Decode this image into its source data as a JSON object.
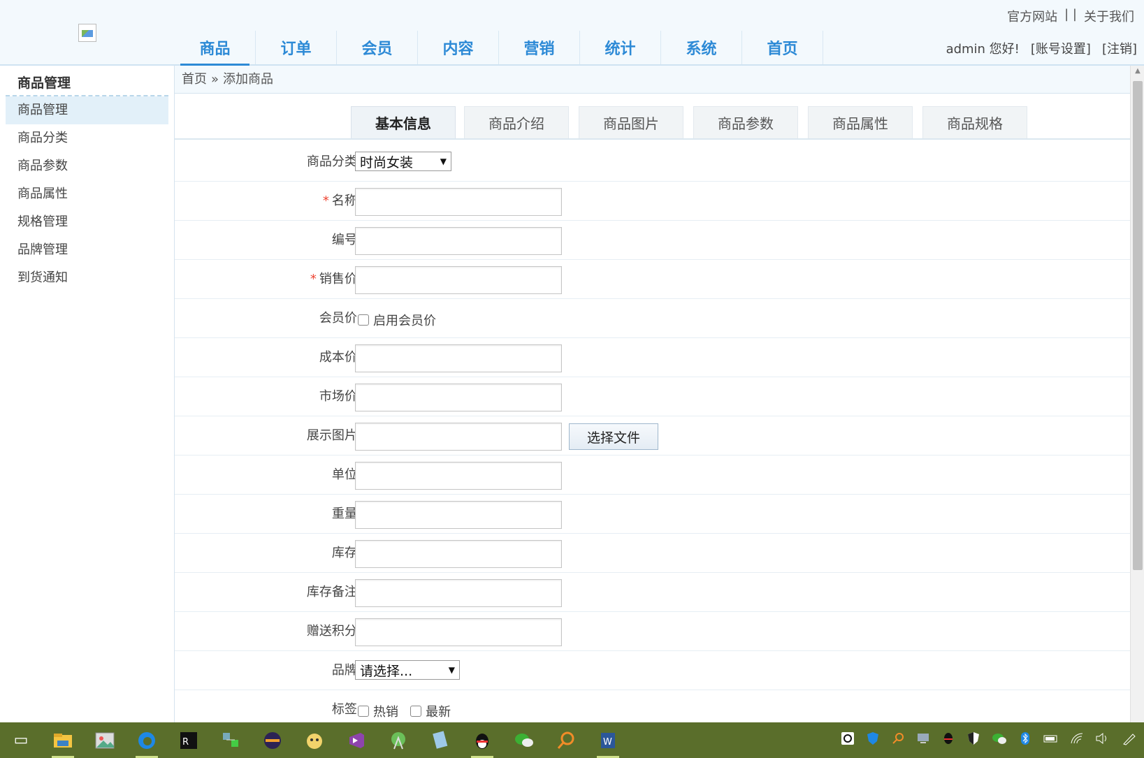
{
  "header": {
    "top_links": [
      "官方网站",
      "| |",
      "关于我们"
    ],
    "nav": [
      "商品",
      "订单",
      "会员",
      "内容",
      "营销",
      "统计",
      "系统",
      "首页"
    ],
    "user_greeting": "admin 您好!",
    "account_settings": "[账号设置]",
    "logout": "[注销]"
  },
  "sidebar": {
    "title": "商品管理",
    "items": [
      "商品管理",
      "商品分类",
      "商品参数",
      "商品属性",
      "规格管理",
      "品牌管理",
      "到货通知"
    ]
  },
  "breadcrumb": {
    "home": "首页",
    "sep": "»",
    "current": "添加商品"
  },
  "tabs": [
    "基本信息",
    "商品介绍",
    "商品图片",
    "商品参数",
    "商品属性",
    "商品规格"
  ],
  "form": {
    "category_label": "商品分类:",
    "category_value": "时尚女装",
    "name_label": "名称:",
    "code_label": "编号:",
    "price_label": "销售价:",
    "member_price_label": "会员价:",
    "member_price_option": "启用会员价",
    "cost_label": "成本价:",
    "market_label": "市场价:",
    "image_label": "展示图片:",
    "file_button": "选择文件",
    "unit_label": "单位:",
    "weight_label": "重量:",
    "stock_label": "库存:",
    "stock_note_label": "库存备注:",
    "points_label": "赠送积分:",
    "brand_label": "品牌:",
    "brand_value": "请选择...",
    "tags_label": "标签:",
    "tag_hot": "热销",
    "tag_new": "最新",
    "required_mark": "*"
  },
  "taskbar": {
    "icons": [
      "task-view-icon",
      "file-explorer-icon",
      "photos-icon",
      "edge-icon",
      "rider-icon",
      "network-icon",
      "eclipse-icon",
      "cat-icon",
      "visual-studio-icon",
      "android-studio-icon",
      "notes-icon",
      "qq-icon",
      "wechat-icon",
      "search-tool-icon",
      "word-icon"
    ],
    "tray_icons": [
      "q-icon",
      "shield-icon",
      "search-icon",
      "computer-icon",
      "qq-tray-icon",
      "security-icon",
      "wechat-tray-icon",
      "bluetooth-icon",
      "battery-icon",
      "wifi-icon",
      "volume-icon",
      "pen-icon"
    ]
  }
}
